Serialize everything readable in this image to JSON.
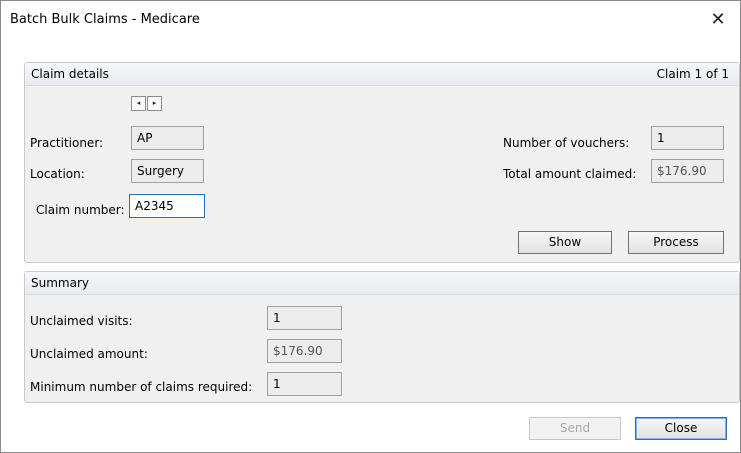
{
  "window": {
    "title": "Batch Bulk Claims - Medicare",
    "close_glyph": "✕"
  },
  "claim_details": {
    "header": "Claim details",
    "counter": "Claim 1 of 1",
    "nav_prev_glyph": "◂",
    "nav_next_glyph": "▸",
    "practitioner_label": "Practitioner:",
    "practitioner_value": "AP",
    "location_label": "Location:",
    "location_value": "Surgery",
    "claim_number_label": "Claim number:",
    "claim_number_value": "A2345",
    "vouchers_label": "Number of vouchers:",
    "vouchers_value": "1",
    "total_label": "Total amount claimed:",
    "total_value": "$176.90",
    "show_button": "Show",
    "process_button": "Process"
  },
  "summary": {
    "header": "Summary",
    "unclaimed_visits_label": "Unclaimed visits:",
    "unclaimed_visits_value": "1",
    "unclaimed_amount_label": "Unclaimed amount:",
    "unclaimed_amount_value": "$176.90",
    "min_claims_label": "Minimum number of claims required:",
    "min_claims_value": "1"
  },
  "footer": {
    "send_button": "Send",
    "close_button": "Close"
  },
  "colors": {
    "accent": "#1e73c8",
    "panel_bg": "#f0f0f0",
    "disabled_text": "#a8a8a8"
  }
}
